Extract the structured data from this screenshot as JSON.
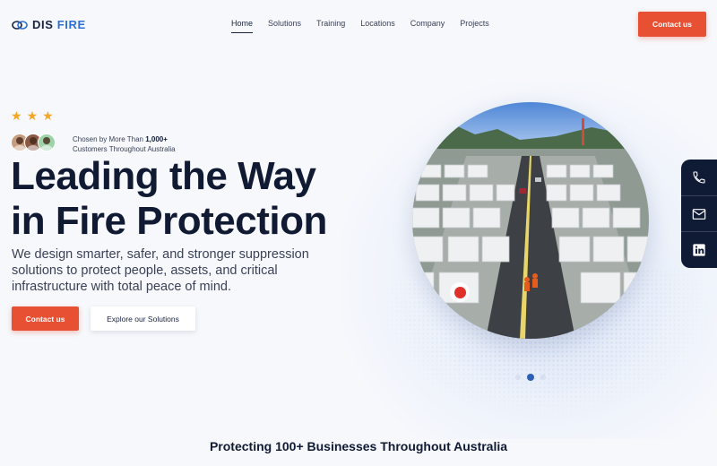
{
  "header": {
    "logo_primary": "DIS",
    "logo_accent": "FIRE",
    "nav": [
      "Home",
      "Solutions",
      "Training",
      "Locations",
      "Company",
      "Projects"
    ],
    "cta_label": "Contact us"
  },
  "hero": {
    "rating_stars": 3,
    "social_proof_prefix": "Chosen by More Than ",
    "social_proof_count": "1,000+",
    "social_proof_suffix": "Customers Throughout Australia",
    "headline_line1": "Leading the Way",
    "headline_line2": "in Fire Protection",
    "subcopy": "We design smarter, safer, and stronger suppression solutions to protect people, assets, and critical infrastructure with total peace of mind.",
    "primary_cta": "Contact us",
    "secondary_cta": "Explore our Solutions"
  },
  "carousel": {
    "slides": 3,
    "active_index": 1
  },
  "side_contact": {
    "icons": [
      "phone-icon",
      "mail-icon",
      "linkedin-icon"
    ]
  },
  "trust_heading": "Protecting 100+ Businesses Throughout Australia",
  "colors": {
    "accent": "#e85034",
    "brand_blue": "#2d6fd6",
    "navy": "#0f1a35",
    "star": "#f5a623"
  }
}
